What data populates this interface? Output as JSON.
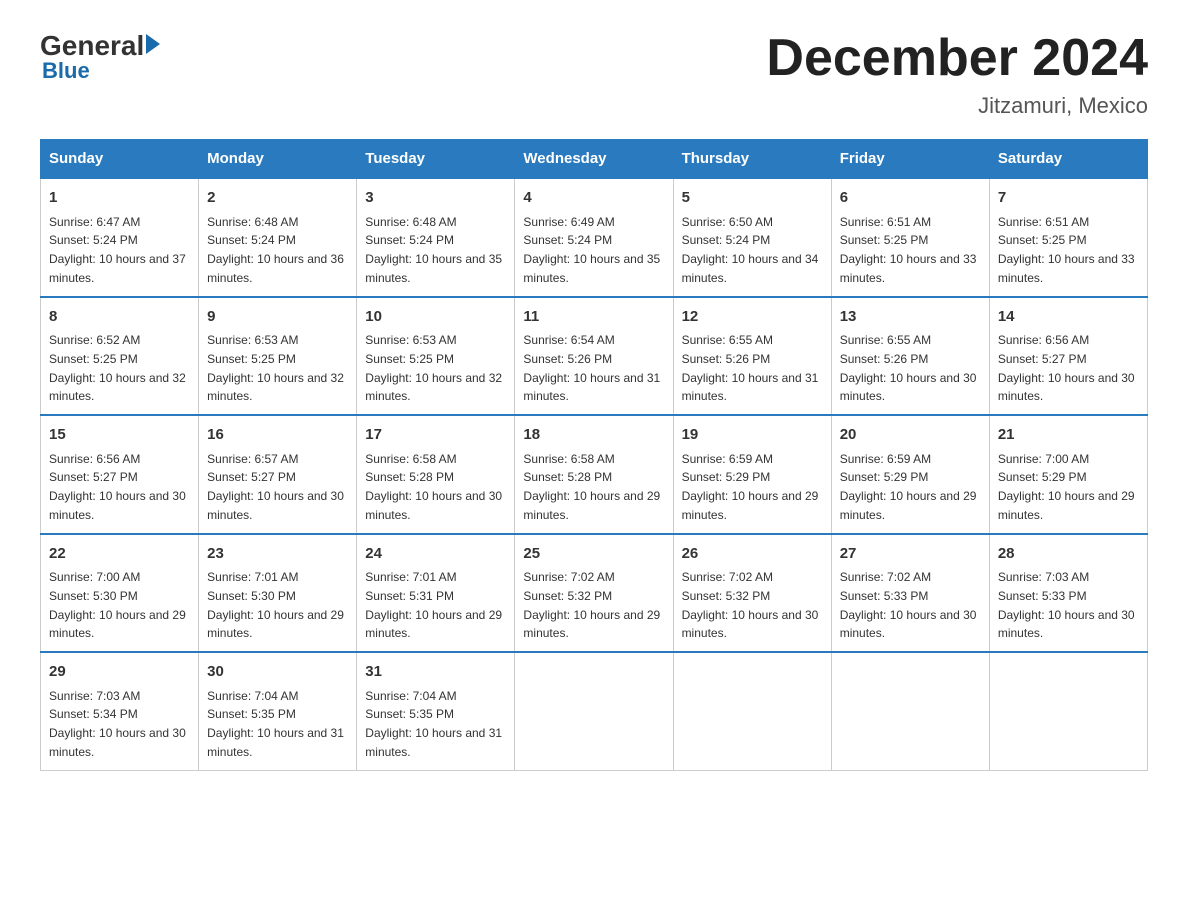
{
  "logo": {
    "general": "General",
    "blue": "Blue"
  },
  "title": "December 2024",
  "location": "Jitzamuri, Mexico",
  "days_of_week": [
    "Sunday",
    "Monday",
    "Tuesday",
    "Wednesday",
    "Thursday",
    "Friday",
    "Saturday"
  ],
  "weeks": [
    [
      {
        "day": "1",
        "sunrise": "6:47 AM",
        "sunset": "5:24 PM",
        "daylight": "10 hours and 37 minutes."
      },
      {
        "day": "2",
        "sunrise": "6:48 AM",
        "sunset": "5:24 PM",
        "daylight": "10 hours and 36 minutes."
      },
      {
        "day": "3",
        "sunrise": "6:48 AM",
        "sunset": "5:24 PM",
        "daylight": "10 hours and 35 minutes."
      },
      {
        "day": "4",
        "sunrise": "6:49 AM",
        "sunset": "5:24 PM",
        "daylight": "10 hours and 35 minutes."
      },
      {
        "day": "5",
        "sunrise": "6:50 AM",
        "sunset": "5:24 PM",
        "daylight": "10 hours and 34 minutes."
      },
      {
        "day": "6",
        "sunrise": "6:51 AM",
        "sunset": "5:25 PM",
        "daylight": "10 hours and 33 minutes."
      },
      {
        "day": "7",
        "sunrise": "6:51 AM",
        "sunset": "5:25 PM",
        "daylight": "10 hours and 33 minutes."
      }
    ],
    [
      {
        "day": "8",
        "sunrise": "6:52 AM",
        "sunset": "5:25 PM",
        "daylight": "10 hours and 32 minutes."
      },
      {
        "day": "9",
        "sunrise": "6:53 AM",
        "sunset": "5:25 PM",
        "daylight": "10 hours and 32 minutes."
      },
      {
        "day": "10",
        "sunrise": "6:53 AM",
        "sunset": "5:25 PM",
        "daylight": "10 hours and 32 minutes."
      },
      {
        "day": "11",
        "sunrise": "6:54 AM",
        "sunset": "5:26 PM",
        "daylight": "10 hours and 31 minutes."
      },
      {
        "day": "12",
        "sunrise": "6:55 AM",
        "sunset": "5:26 PM",
        "daylight": "10 hours and 31 minutes."
      },
      {
        "day": "13",
        "sunrise": "6:55 AM",
        "sunset": "5:26 PM",
        "daylight": "10 hours and 30 minutes."
      },
      {
        "day": "14",
        "sunrise": "6:56 AM",
        "sunset": "5:27 PM",
        "daylight": "10 hours and 30 minutes."
      }
    ],
    [
      {
        "day": "15",
        "sunrise": "6:56 AM",
        "sunset": "5:27 PM",
        "daylight": "10 hours and 30 minutes."
      },
      {
        "day": "16",
        "sunrise": "6:57 AM",
        "sunset": "5:27 PM",
        "daylight": "10 hours and 30 minutes."
      },
      {
        "day": "17",
        "sunrise": "6:58 AM",
        "sunset": "5:28 PM",
        "daylight": "10 hours and 30 minutes."
      },
      {
        "day": "18",
        "sunrise": "6:58 AM",
        "sunset": "5:28 PM",
        "daylight": "10 hours and 29 minutes."
      },
      {
        "day": "19",
        "sunrise": "6:59 AM",
        "sunset": "5:29 PM",
        "daylight": "10 hours and 29 minutes."
      },
      {
        "day": "20",
        "sunrise": "6:59 AM",
        "sunset": "5:29 PM",
        "daylight": "10 hours and 29 minutes."
      },
      {
        "day": "21",
        "sunrise": "7:00 AM",
        "sunset": "5:29 PM",
        "daylight": "10 hours and 29 minutes."
      }
    ],
    [
      {
        "day": "22",
        "sunrise": "7:00 AM",
        "sunset": "5:30 PM",
        "daylight": "10 hours and 29 minutes."
      },
      {
        "day": "23",
        "sunrise": "7:01 AM",
        "sunset": "5:30 PM",
        "daylight": "10 hours and 29 minutes."
      },
      {
        "day": "24",
        "sunrise": "7:01 AM",
        "sunset": "5:31 PM",
        "daylight": "10 hours and 29 minutes."
      },
      {
        "day": "25",
        "sunrise": "7:02 AM",
        "sunset": "5:32 PM",
        "daylight": "10 hours and 29 minutes."
      },
      {
        "day": "26",
        "sunrise": "7:02 AM",
        "sunset": "5:32 PM",
        "daylight": "10 hours and 30 minutes."
      },
      {
        "day": "27",
        "sunrise": "7:02 AM",
        "sunset": "5:33 PM",
        "daylight": "10 hours and 30 minutes."
      },
      {
        "day": "28",
        "sunrise": "7:03 AM",
        "sunset": "5:33 PM",
        "daylight": "10 hours and 30 minutes."
      }
    ],
    [
      {
        "day": "29",
        "sunrise": "7:03 AM",
        "sunset": "5:34 PM",
        "daylight": "10 hours and 30 minutes."
      },
      {
        "day": "30",
        "sunrise": "7:04 AM",
        "sunset": "5:35 PM",
        "daylight": "10 hours and 31 minutes."
      },
      {
        "day": "31",
        "sunrise": "7:04 AM",
        "sunset": "5:35 PM",
        "daylight": "10 hours and 31 minutes."
      },
      null,
      null,
      null,
      null
    ]
  ]
}
